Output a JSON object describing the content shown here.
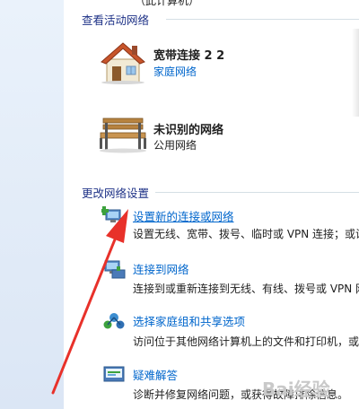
{
  "top_partial_text": "（此计算机）",
  "active_networks": {
    "heading": "查看活动网络",
    "networks": [
      {
        "name": "宽带连接 2  2",
        "type": "家庭网络",
        "type_is_link": true,
        "icon": "house-icon"
      },
      {
        "name": "未识别的网络",
        "type": "公用网络",
        "type_is_link": false,
        "icon": "park-bench-icon"
      }
    ]
  },
  "change_settings": {
    "heading": "更改网络设置",
    "tasks": [
      {
        "label": "设置新的连接或网络",
        "description": "设置无线、宽带、拨号、临时或 VPN 连接；或设",
        "icon": "new-connection-icon"
      },
      {
        "label": "连接到网络",
        "description": "连接到或重新连接到无线、有线、拨号或 VPN 网",
        "icon": "connect-network-icon"
      },
      {
        "label": "选择家庭组和共享选项",
        "description": "访问位于其他网络计算机上的文件和打印机，或",
        "icon": "homegroup-icon"
      },
      {
        "label": "疑难解答",
        "description": "诊断并修复网络问题，或获得故障排除信息。",
        "icon": "troubleshoot-icon"
      }
    ]
  },
  "watermark": "Bai经验",
  "colors": {
    "link": "#0066cc",
    "heading": "#1e3287",
    "arrow": "#e8312a"
  }
}
